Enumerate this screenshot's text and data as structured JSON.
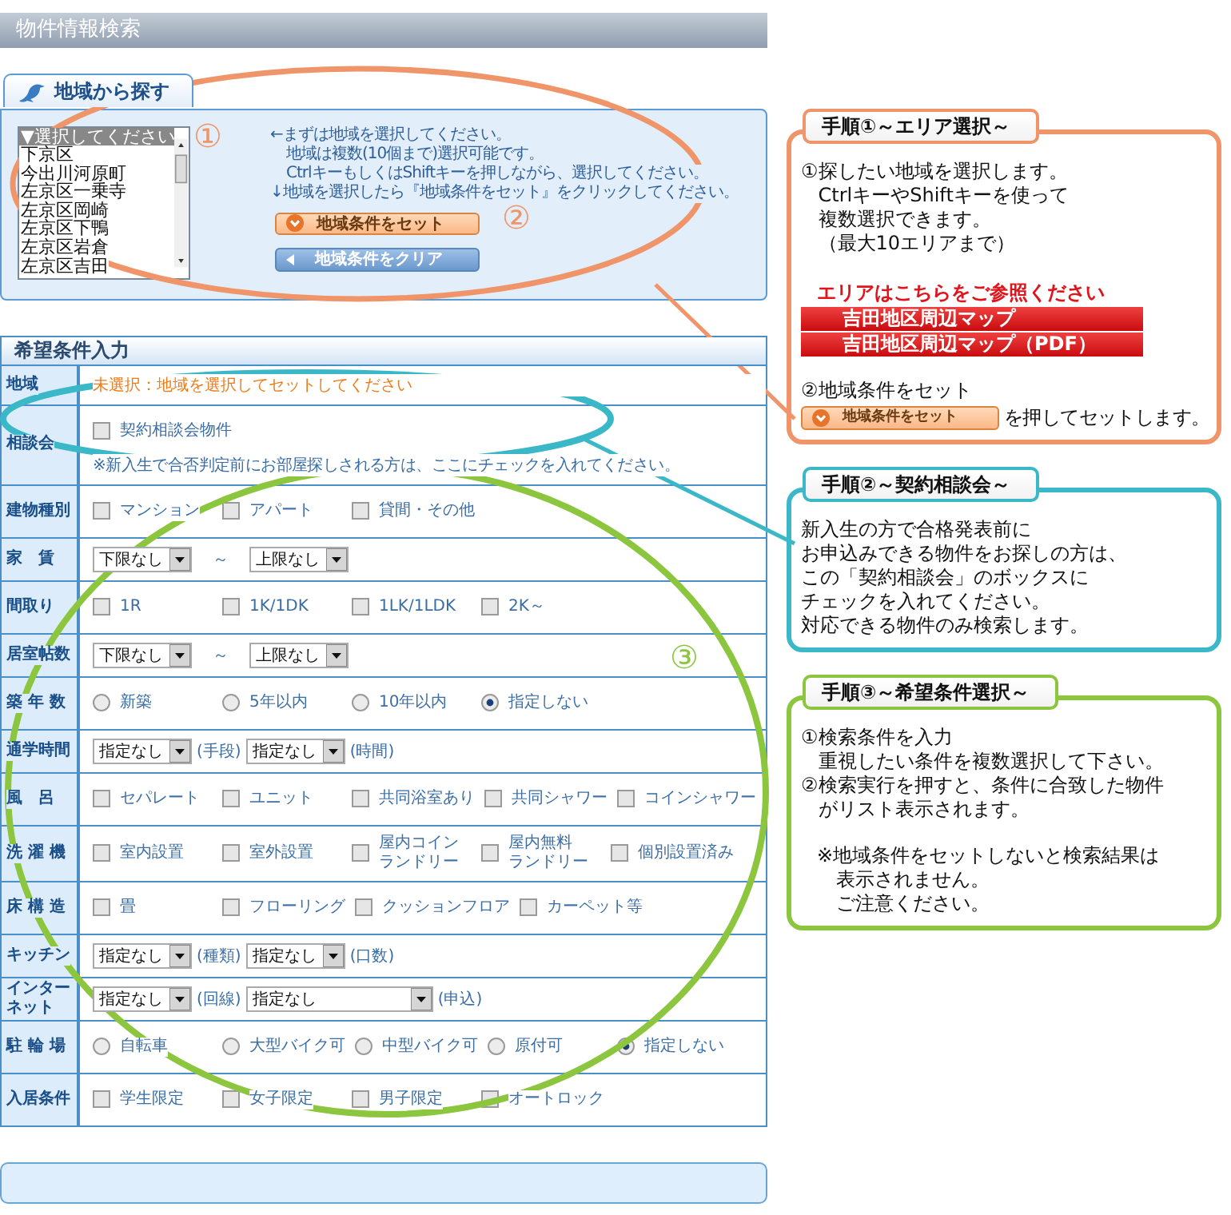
{
  "title": "物件情報検索",
  "area": {
    "tab": "地域から探す",
    "list": [
      {
        "label": "▼選択してください",
        "selected": true
      },
      {
        "label": "下京区",
        "selected": false
      },
      {
        "label": "今出川河原町",
        "selected": false
      },
      {
        "label": "左京区一乗寺",
        "selected": false
      },
      {
        "label": "左京区岡崎",
        "selected": false
      },
      {
        "label": "左京区下鴨",
        "selected": false
      },
      {
        "label": "左京区岩倉",
        "selected": false
      },
      {
        "label": "左京区吉田",
        "selected": false
      }
    ],
    "notes": [
      {
        "text": "←まずは地域を選択してください。",
        "children": [
          {
            "text": "地域は複数(10個まで)選択可能です。"
          },
          {
            "text": "CtrlキーもしくはShiftキーを押しながら、選択してください。"
          }
        ]
      },
      {
        "text": "↓地域を選択したら『地域条件をセット』をクリックしてください。"
      }
    ],
    "buttons": [
      {
        "kind": "set",
        "label": "地域条件をセット"
      },
      {
        "kind": "clear",
        "label": "地域条件をクリア"
      }
    ]
  },
  "form": {
    "title": "希望条件入力",
    "rows": [
      {
        "label": "地域",
        "kind": "notice",
        "text": "未選択：地域を選択してセットしてください"
      },
      {
        "label": "相談会",
        "kind": "checks",
        "options": [
          {
            "label": "契約相談会物件",
            "checked": false
          }
        ],
        "note": "※新入生で合否判定前にお部屋探しされる方は、ここにチェックを入れてください。"
      },
      {
        "label": "建物種別",
        "kind": "checks",
        "options": [
          {
            "label": "マンション",
            "checked": false
          },
          {
            "label": "アパート",
            "checked": false
          },
          {
            "label": "貸間・その他",
            "checked": false
          }
        ]
      },
      {
        "label": "家　賃",
        "kind": "range",
        "from": "下限なし",
        "sep": "～",
        "to": "上限なし"
      },
      {
        "label": "間取り",
        "kind": "checks",
        "options": [
          {
            "label": "1R",
            "checked": false
          },
          {
            "label": "1K/1DK",
            "checked": false
          },
          {
            "label": "1LK/1LDK",
            "checked": false
          },
          {
            "label": "2K～",
            "checked": false
          }
        ]
      },
      {
        "label": "居室帖数",
        "kind": "range",
        "from": "下限なし",
        "sep": "～",
        "to": "上限なし"
      },
      {
        "label": "築 年 数",
        "kind": "radios",
        "options": [
          {
            "label": "新築",
            "selected": false
          },
          {
            "label": "5年以内",
            "selected": false
          },
          {
            "label": "10年以内",
            "selected": false
          },
          {
            "label": "指定しない",
            "selected": true
          }
        ]
      },
      {
        "label": "通学時間",
        "kind": "selects",
        "selects": [
          {
            "value": "指定なし",
            "suffix": "(手段)",
            "wide": false
          },
          {
            "value": "指定なし",
            "suffix": "(時間)",
            "wide": false
          }
        ]
      },
      {
        "label": "風　呂",
        "kind": "checks",
        "options": [
          {
            "label": "セパレート",
            "checked": false
          },
          {
            "label": "ユニット",
            "checked": false
          },
          {
            "label": "共同浴室あり",
            "checked": false
          },
          {
            "label": "共同シャワー",
            "checked": false
          },
          {
            "label": "コインシャワー",
            "checked": false
          }
        ]
      },
      {
        "label": "洗 濯 機",
        "kind": "checks",
        "options": [
          {
            "label": "室内設置",
            "checked": false
          },
          {
            "label": "室外設置",
            "checked": false
          },
          {
            "lines": [
              "屋内コイン",
              "ランドリー"
            ],
            "checked": false
          },
          {
            "lines": [
              "屋内無料",
              "ランドリー"
            ],
            "checked": false
          },
          {
            "label": "個別設置済み",
            "checked": false
          }
        ]
      },
      {
        "label": "床 構 造",
        "kind": "checks",
        "options": [
          {
            "label": "畳",
            "checked": false
          },
          {
            "label": "フローリング",
            "checked": false
          },
          {
            "label": "クッションフロア",
            "checked": false
          },
          {
            "label": "カーペット等",
            "checked": false
          }
        ]
      },
      {
        "label": "キッチン",
        "kind": "selects",
        "selects": [
          {
            "value": "指定なし",
            "suffix": "(種類)",
            "wide": false
          },
          {
            "value": "指定なし",
            "suffix": "(口数)",
            "wide": false
          }
        ]
      },
      {
        "lines": [
          "インター",
          "ネット"
        ],
        "kind": "selects",
        "selects": [
          {
            "value": "指定なし",
            "suffix": "(回線)",
            "wide": false
          },
          {
            "value": "指定なし",
            "suffix": "(申込)",
            "wide": true
          }
        ]
      },
      {
        "label": "駐 輪 場",
        "kind": "radios",
        "options": [
          {
            "label": "自転車",
            "selected": false
          },
          {
            "label": "大型バイク可",
            "selected": false
          },
          {
            "label": "中型バイク可",
            "selected": false
          },
          {
            "label": "原付可",
            "selected": false
          },
          {
            "label": "指定しない",
            "selected": true
          }
        ]
      },
      {
        "label": "入居条件",
        "kind": "checks",
        "options": [
          {
            "label": "学生限定",
            "checked": false
          },
          {
            "label": "女子限定",
            "checked": false
          },
          {
            "label": "男子限定",
            "checked": false
          },
          {
            "label": "オートロック",
            "checked": false
          }
        ]
      }
    ]
  },
  "annotations": [
    {
      "label": "①",
      "color": "#f0956a"
    },
    {
      "label": "②",
      "color": "#f0956a"
    },
    {
      "label": "③",
      "color": "#8cc63f"
    }
  ],
  "callouts": [
    {
      "title": "手順①～エリア選択～",
      "color": "#f0956a",
      "body": [
        {
          "kind": "step",
          "number": "①",
          "lines": [
            "探したい地域を選択します。",
            "CtrlキーやShiftキーを使って",
            "複数選択できます。",
            "（最大10エリアまで）"
          ]
        },
        {
          "kind": "heading",
          "text": "エリアはこちらをご参照ください"
        },
        {
          "kind": "link",
          "text": "吉田地区周辺マップ"
        },
        {
          "kind": "link",
          "text": "吉田地区周辺マップ（PDF）"
        },
        {
          "kind": "step",
          "number": "②",
          "lines": [
            "地域条件をセット"
          ]
        },
        {
          "kind": "action",
          "button": "地域条件をセット",
          "text": "を押してセットします。"
        }
      ]
    },
    {
      "title": "手順②～契約相談会～",
      "color": "#3bb8c8",
      "body": [
        {
          "kind": "text",
          "lines": [
            "新入生の方で合格発表前に",
            "お申込みできる物件をお探しの方は、",
            "この「契約相談会」のボックスに",
            "チェックを入れてください。",
            "対応できる物件のみ検索します。"
          ]
        }
      ]
    },
    {
      "title": "手順③～希望条件選択～",
      "color": "#8cc63f",
      "body": [
        {
          "kind": "step",
          "number": "①",
          "lines": [
            "検索条件を入力",
            "重視したい条件を複数選択して下さい。"
          ]
        },
        {
          "kind": "step",
          "number": "②",
          "lines": [
            "検索実行を押すと、条件に合致した物件",
            "がリスト表示されます。"
          ]
        },
        {
          "kind": "note",
          "lines": [
            "※地域条件をセットしないと検索結果は",
            "表示されません。",
            "ご注意ください。"
          ]
        }
      ]
    }
  ]
}
